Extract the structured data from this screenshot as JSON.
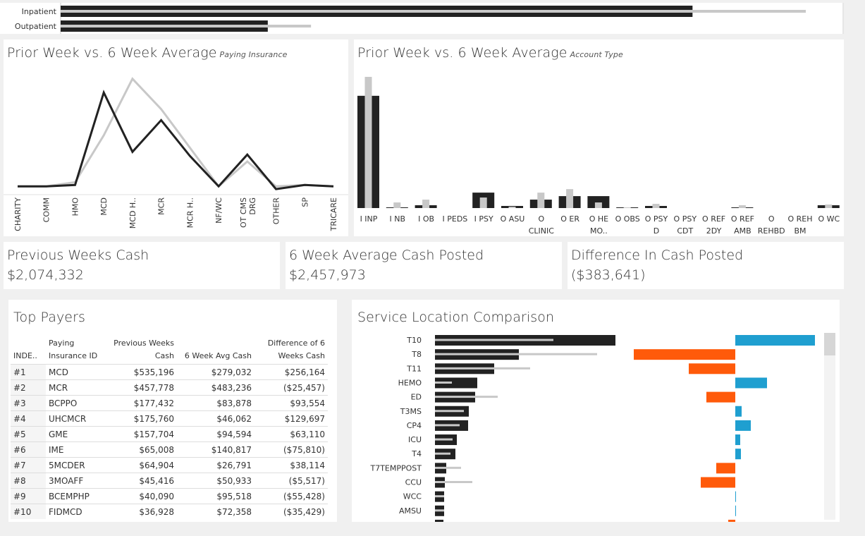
{
  "top_bars": {
    "categories": [
      "Inpatient",
      "Outpatient"
    ],
    "prior_week_width": [
      0.848,
      0.278
    ],
    "six_week_avg_width": [
      1.0,
      0.336
    ]
  },
  "insurance_chart": {
    "title": "Prior Week vs. 6 Week Average",
    "subtitle": "Paying Insurance"
  },
  "account_chart": {
    "title": "Prior Week vs. 6 Week Average",
    "subtitle": "Account Type"
  },
  "kpis": [
    {
      "title": "Previous Weeks Cash",
      "value": "$2,074,332"
    },
    {
      "title": "6 Week Average Cash Posted",
      "value": "$2,457,973"
    },
    {
      "title": "Difference In Cash Posted",
      "value": "($383,641)"
    }
  ],
  "top_payers": {
    "title": "Top Payers",
    "headers": [
      "INDE..",
      "Paying Insurance ID",
      "Previous Weeks Cash",
      "6 Week Avg Cash",
      "Difference of 6 Weeks Cash"
    ],
    "rows": [
      [
        "#1",
        "MCD",
        "$535,196",
        "$279,032",
        "$256,164"
      ],
      [
        "#2",
        "MCR",
        "$457,778",
        "$483,236",
        "($25,457)"
      ],
      [
        "#3",
        "BCPPO",
        "$177,432",
        "$83,878",
        "$93,554"
      ],
      [
        "#4",
        "UHCMCR",
        "$175,760",
        "$46,062",
        "$129,697"
      ],
      [
        "#5",
        "GME",
        "$157,704",
        "$94,594",
        "$63,110"
      ],
      [
        "#6",
        "IME",
        "$65,008",
        "$140,817",
        "($75,810)"
      ],
      [
        "#7",
        "5MCDER",
        "$64,904",
        "$26,791",
        "$38,114"
      ],
      [
        "#8",
        "3MOAFF",
        "$45,416",
        "$50,933",
        "($5,517)"
      ],
      [
        "#9",
        "BCEMPHP",
        "$40,090",
        "$95,518",
        "($55,428)"
      ],
      [
        "#10",
        "FIDMCD",
        "$36,928",
        "$72,358",
        "($35,429)"
      ]
    ]
  },
  "service_location": {
    "title": "Service Location Comparison"
  },
  "colors": {
    "prior": "#222222",
    "avg": "#c8c8c8",
    "positive": "#1f9fd0",
    "negative": "#ff5a0a"
  },
  "chart_data": [
    {
      "type": "line",
      "categories": [
        "CHARITY",
        "COMM",
        "HMO",
        "MCD",
        "MCD H..",
        "MCR",
        "MCR H..",
        "NF/WC",
        "OT CMS DRG",
        "OTHER",
        "SP",
        "TRICARE"
      ],
      "series": [
        {
          "values": [
            0,
            0,
            1,
            68,
            25,
            48,
            22,
            0,
            23,
            -2,
            1,
            0
          ]
        },
        {
          "values": [
            0,
            0,
            3,
            37,
            78,
            56,
            28,
            0,
            18,
            0,
            1,
            0
          ]
        }
      ],
      "ylim": [
        -5,
        85
      ],
      "grid": false,
      "legend": "none"
    },
    {
      "type": "bar",
      "categories": [
        "I INP",
        "I NB",
        "I OB",
        "I PEDS",
        "I PSY",
        "O ASU",
        "O CLINIC",
        "O ER",
        "O HE MO..",
        "O OBS",
        "O PSY D",
        "O PSY CDT",
        "O REF 2DY",
        "O REF AMB",
        "O REHBD",
        "O REH BM",
        "O WC"
      ],
      "series": [
        {
          "values": [
            160,
            1,
            4,
            0,
            22,
            3,
            12,
            17,
            17,
            1,
            3,
            0,
            0,
            1,
            0,
            0,
            4
          ]
        },
        {
          "values": [
            187,
            8,
            12,
            0,
            15,
            2,
            22,
            27,
            8,
            1,
            6,
            0,
            0,
            4,
            0,
            0,
            5
          ]
        }
      ],
      "ylim": [
        0,
        190
      ],
      "grid": false,
      "legend": "none"
    },
    {
      "type": "bar",
      "orientation": "horizontal",
      "categories": [
        "T10",
        "T8",
        "T11",
        "HEMO",
        "ED",
        "T3MS",
        "CP4",
        "ICU",
        "T4",
        "T7TEMPPOST",
        "CCU",
        "WCC",
        "AMSU"
      ],
      "series": [
        {
          "values": [
            256,
            119,
            84,
            60,
            57,
            48,
            47,
            31,
            29,
            16,
            14,
            13,
            13
          ]
        },
        {
          "values": [
            168,
            230,
            135,
            24,
            89,
            41,
            35,
            25,
            22,
            37,
            53,
            13,
            13
          ]
        }
      ],
      "difference": [
        113,
        -144,
        -66,
        45,
        -41,
        9,
        22,
        7,
        8,
        -27,
        -49,
        0.5,
        0.5
      ],
      "diff_lim": [
        -144,
        113
      ],
      "grid": false,
      "legend": "none"
    }
  ]
}
